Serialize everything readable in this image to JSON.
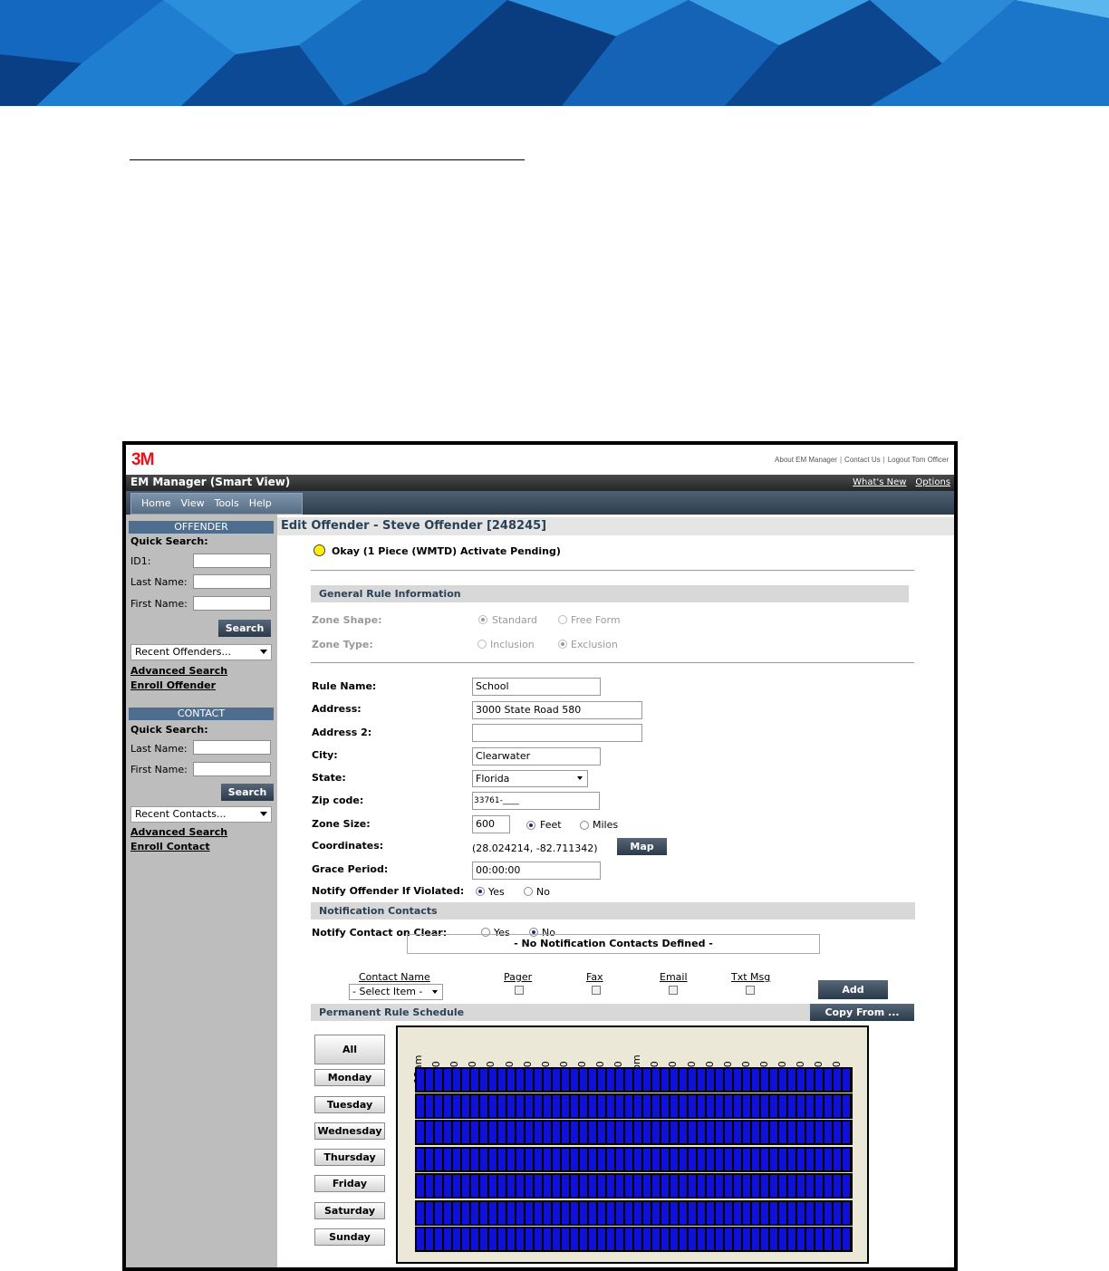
{
  "app": {
    "logo": "3M",
    "top_links": [
      "About EM Manager",
      "Contact Us",
      "Logout Tom Officer"
    ],
    "title": "EM Manager (Smart View)",
    "header_links": [
      "What's New",
      "Options"
    ],
    "menu": [
      "Home",
      "View",
      "Tools",
      "Help"
    ]
  },
  "sidebar": {
    "offender": {
      "header": "OFFENDER",
      "quick_search": "Quick Search:",
      "id1": "ID1:",
      "last_name": "Last Name:",
      "first_name": "First Name:",
      "search": "Search",
      "recent": "Recent Offenders...",
      "advanced_search": "Advanced Search",
      "enroll": "Enroll Offender"
    },
    "contact": {
      "header": "CONTACT",
      "quick_search": "Quick Search:",
      "last_name": "Last Name:",
      "first_name": "First Name:",
      "search": "Search",
      "recent": "Recent Contacts...",
      "advanced_search": "Advanced Search",
      "enroll": "Enroll Contact"
    }
  },
  "main": {
    "title": "Edit Offender - Steve Offender [248245]",
    "status": "Okay (1 Piece (WMTD) Activate Pending)",
    "status_color": "#ffee00",
    "general": {
      "header": "General Rule Information",
      "zone_shape_label": "Zone Shape:",
      "zone_shape_options": [
        "Standard",
        "Free Form"
      ],
      "zone_shape_selected": "Standard",
      "zone_type_label": "Zone Type:",
      "zone_type_options": [
        "Inclusion",
        "Exclusion"
      ],
      "zone_type_selected": "Exclusion"
    },
    "form": {
      "rule_name_label": "Rule Name:",
      "rule_name": "School",
      "address_label": "Address:",
      "address": "3000 State Road 580",
      "address2_label": "Address 2:",
      "address2": "",
      "city_label": "City:",
      "city": "Clearwater",
      "state_label": "State:",
      "state": "Florida",
      "zip_label": "Zip code:",
      "zip": "33761-____",
      "zone_size_label": "Zone Size:",
      "zone_size": "600",
      "unit_options": [
        "Feet",
        "Miles"
      ],
      "unit_selected": "Feet",
      "coordinates_label": "Coordinates:",
      "coordinates": "(28.024214, -82.711342)",
      "map_button": "Map",
      "grace_label": "Grace Period:",
      "grace": "00:00:00",
      "notify_label": "Notify Offender If Violated:",
      "notify_options": [
        "Yes",
        "No"
      ],
      "notify_selected": "Yes"
    },
    "notification": {
      "header": "Notification Contacts",
      "clear_label": "Notify Contact on Clear:",
      "clear_options": [
        "Yes",
        "No"
      ],
      "clear_selected": "No",
      "empty_message": "- No Notification Contacts Defined -",
      "columns": [
        "Contact Name",
        "Pager",
        "Fax",
        "Email",
        "Txt Msg"
      ],
      "select_placeholder": "- Select Item -",
      "add_button": "Add"
    },
    "schedule": {
      "header": "Permanent Rule Schedule",
      "copy_button": "Copy From ...",
      "all_button": "All",
      "days": [
        "Monday",
        "Tuesday",
        "Wednesday",
        "Thursday",
        "Friday",
        "Saturday",
        "Sunday"
      ],
      "hours": [
        "12am",
        "1:00",
        "2:00",
        "3:00",
        "4:00",
        "5:00",
        "6:00",
        "7:00",
        "8:00",
        "9:00",
        "10:00",
        "11:00",
        "12pm",
        "1:00",
        "2:00",
        "3:00",
        "4:00",
        "5:00",
        "6:00",
        "7:00",
        "8:00",
        "9:00",
        "10:00",
        "11:00"
      ],
      "cell_color": "#0f10d8"
    }
  }
}
